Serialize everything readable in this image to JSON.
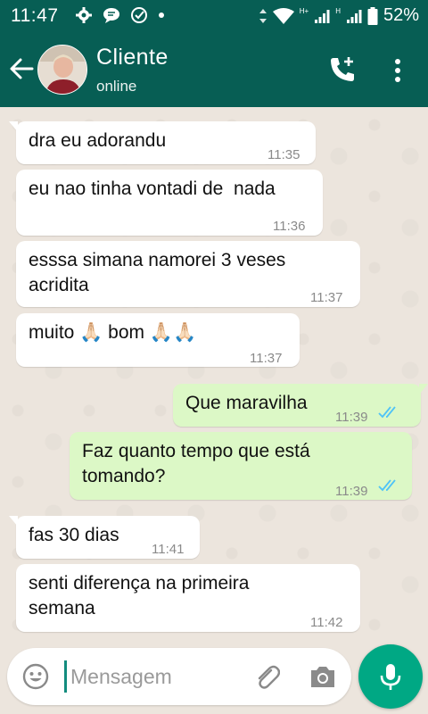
{
  "status_bar": {
    "time": "11:47",
    "network_badge_1": "H+",
    "network_badge_2": "H",
    "battery": "52%",
    "icons": [
      "settings-icon",
      "chat-bubble-icon",
      "check-circle-icon",
      "dot-icon",
      "data-arrows-icon",
      "wifi-icon",
      "signal-icon",
      "signal-icon",
      "battery-icon"
    ]
  },
  "header": {
    "contact_name": "Cliente",
    "contact_status": "online",
    "icons": [
      "back-arrow-icon",
      "avatar",
      "add-call-icon",
      "more-vert-icon"
    ]
  },
  "messages": [
    {
      "direction": "in",
      "text": "dra eu adorandu",
      "time": "11:35"
    },
    {
      "direction": "in",
      "text": "eu nao tinha vontadi de  nada",
      "time": "11:36"
    },
    {
      "direction": "in",
      "text": "esssa simana namorei 3 veses\nacridita",
      "time": "11:37"
    },
    {
      "direction": "in",
      "text": "muito 🙏🏻 bom 🙏🏻🙏🏻",
      "time": "11:37"
    },
    {
      "direction": "out",
      "text": "Que maravilha",
      "time": "11:39",
      "status": "read"
    },
    {
      "direction": "out",
      "text": "Faz quanto tempo que está\ntomando?",
      "time": "11:39",
      "status": "read"
    },
    {
      "direction": "in",
      "text": "fas 30 dias",
      "time": "11:41"
    },
    {
      "direction": "in",
      "text": "senti diferença na primeira\nsemana",
      "time": "11:42"
    }
  ],
  "composer": {
    "placeholder": "Mensagem",
    "value": ""
  },
  "colors": {
    "header": "#075e54",
    "chat_background": "#ece5dd",
    "incoming_bubble": "#ffffff",
    "outgoing_bubble": "#dcf8c6",
    "read_ticks": "#4fc3f7",
    "mic_button": "#00a884"
  }
}
